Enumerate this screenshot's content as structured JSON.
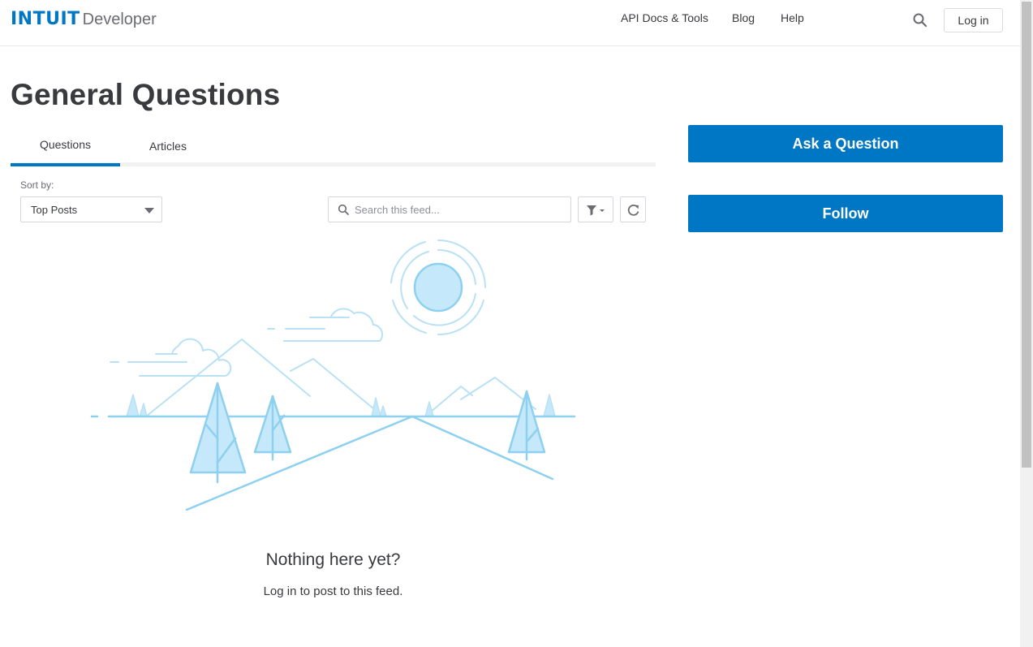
{
  "header": {
    "logo_brand": "INTUIT",
    "logo_product": "Developer",
    "nav": [
      "API Docs & Tools",
      "Blog",
      "Help"
    ],
    "login_label": "Log in"
  },
  "page": {
    "title": "General Questions"
  },
  "tabs": [
    {
      "label": "Questions",
      "active": true
    },
    {
      "label": "Articles",
      "active": false
    }
  ],
  "feed": {
    "sort_label": "Sort by:",
    "sort_value": "Top Posts",
    "search_placeholder": "Search this feed...",
    "empty_title": "Nothing here yet?",
    "empty_subtitle": "Log in to post to this feed."
  },
  "sidebar": {
    "ask_label": "Ask a Question",
    "follow_label": "Follow"
  },
  "colors": {
    "brand_blue": "#0077c5",
    "illustration_blue": "#8dd0f0",
    "illustration_fill": "#c5e8fa"
  }
}
